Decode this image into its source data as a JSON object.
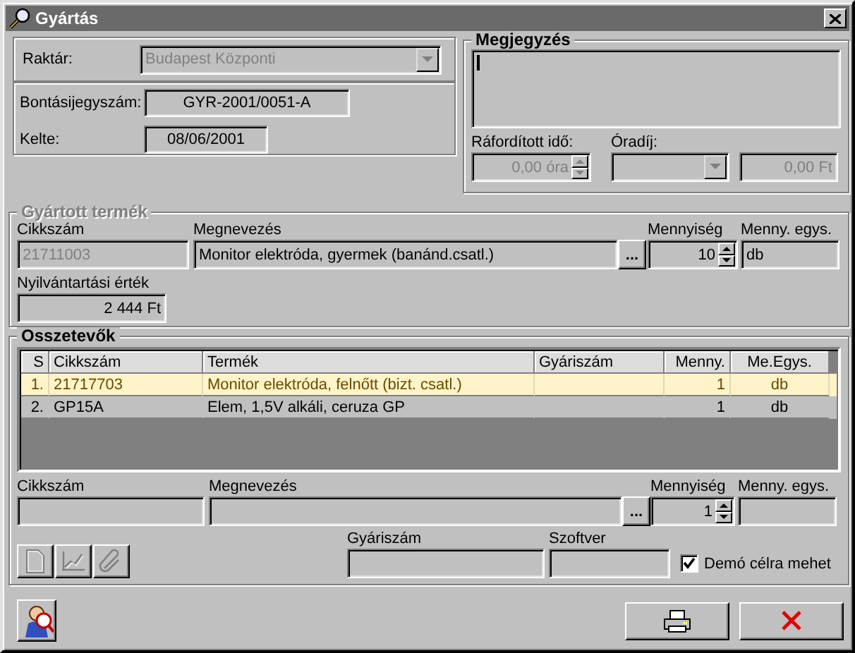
{
  "window": {
    "title": "Gyártás"
  },
  "header": {
    "warehouse": {
      "label": "Raktár:",
      "value": "Budapest Központi",
      "disabled": true
    },
    "document_number": {
      "label": "Bontásijegyszám:",
      "value": "GYR-2001/0051-A"
    },
    "date": {
      "label": "Kelte:",
      "value": "08/06/2001"
    }
  },
  "note": {
    "title": "Megjegyzés",
    "time_label": "Ráfordított idő:",
    "time_value": "0,00 óra",
    "rate_label": "Óradíj:",
    "amount_value": "0,00 Ft",
    "disabled": true
  },
  "product": {
    "title": "Gyártott termék",
    "disabled": true,
    "code_label": "Cikkszám",
    "code": "21711003",
    "name_label": "Megnevezés",
    "name": "Monitor elektróda, gyermek (banánd.csatl.)",
    "browse": "...",
    "quantity_label": "Mennyiség",
    "quantity": "10",
    "unit_label": "Menny. egys.",
    "unit": "db",
    "value_label": "Nyilvántartási érték",
    "value": "2 444 Ft"
  },
  "components": {
    "title": "Osszetevők",
    "columns": [
      "S",
      "Cikkszám",
      "Termék",
      "Gyáriszám",
      "Menny.",
      "Me.Egys."
    ],
    "rows": [
      {
        "s": "1.",
        "code": "21717703",
        "product": "Monitor elektróda, felnőtt (bizt. csatl.)",
        "quantity": "1",
        "unit": "db",
        "selected": true
      },
      {
        "s": "2.",
        "code": "GP15A",
        "product": "Elem, 1,5V alkáli, ceruza GP",
        "quantity": "1",
        "unit": "db",
        "selected": false
      }
    ]
  },
  "editor": {
    "code_label": "Cikkszám",
    "name_label": "Megnevezés",
    "browse": "...",
    "quantity_label": "Mennyiség",
    "quantity": "1",
    "unit_label": "Menny. egys.",
    "serial_label": "Gyáriszám",
    "software_label": "Szoftver",
    "demo": {
      "label": "Demó célra mehet",
      "checked": true
    },
    "tools": [
      {
        "kind": "document",
        "disabled": true
      },
      {
        "kind": "chart",
        "disabled": true
      },
      {
        "kind": "clip",
        "disabled": true
      }
    ]
  },
  "footer": {
    "buttons": [
      {
        "kind": "person"
      },
      {
        "kind": "print"
      },
      {
        "kind": "close"
      }
    ]
  }
}
